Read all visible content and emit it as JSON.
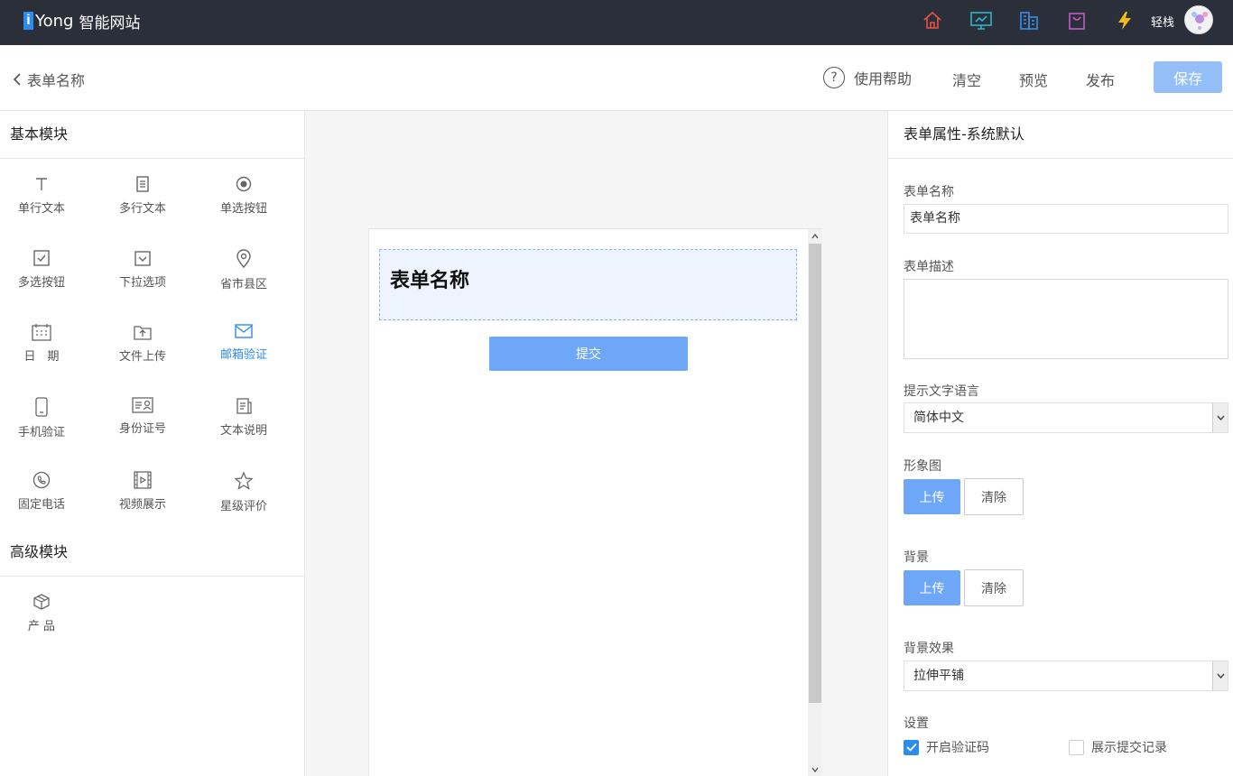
{
  "brand": {
    "mark": "i",
    "name": "Yong",
    "subtitle": "智能网站"
  },
  "topbar": {
    "icons": [
      "home-icon",
      "monitor-icon",
      "building-icon",
      "bag-icon",
      "lightning-icon"
    ],
    "user_name": "轻栈"
  },
  "subheader": {
    "back_label": "表单名称",
    "help_label": "使用帮助",
    "clear_label": "清空",
    "preview_label": "预览",
    "publish_label": "发布",
    "save_label": "保存"
  },
  "left": {
    "basic_title": "基本模块",
    "basic_modules": [
      {
        "label": "单行文本",
        "icon": "text-icon"
      },
      {
        "label": "多行文本",
        "icon": "textarea-icon"
      },
      {
        "label": "单选按钮",
        "icon": "radio-icon"
      },
      {
        "label": "多选按钮",
        "icon": "checkbox-icon"
      },
      {
        "label": "下拉选项",
        "icon": "dropdown-icon"
      },
      {
        "label": "省市县区",
        "icon": "location-icon"
      },
      {
        "label": "日　期",
        "icon": "calendar-icon"
      },
      {
        "label": "文件上传",
        "icon": "upload-icon"
      },
      {
        "label": "邮箱验证",
        "icon": "mail-icon"
      },
      {
        "label": "手机验证",
        "icon": "mobile-icon"
      },
      {
        "label": "身份证号",
        "icon": "idcard-icon"
      },
      {
        "label": "文本说明",
        "icon": "document-icon"
      },
      {
        "label": "固定电话",
        "icon": "phone-icon"
      },
      {
        "label": "视频展示",
        "icon": "video-icon"
      },
      {
        "label": "星级评价",
        "icon": "star-icon"
      }
    ],
    "advanced_title": "高级模块",
    "advanced_modules": [
      {
        "label": "产 品",
        "icon": "cube-icon"
      }
    ]
  },
  "preview": {
    "form_title": "表单名称",
    "submit_label": "提交"
  },
  "right": {
    "title": "表单属性-系统默认",
    "name_label": "表单名称",
    "name_value": "表单名称",
    "desc_label": "表单描述",
    "desc_value": "",
    "lang_label": "提示文字语言",
    "lang_value": "简体中文",
    "image_label": "形象图",
    "upload_label": "上传",
    "clear_label": "清除",
    "bg_label": "背景",
    "bg_effect_label": "背景效果",
    "bg_effect_value": "拉伸平铺",
    "settings_label": "设置",
    "captcha_label": "开启验证码",
    "captcha_checked": true,
    "records_label": "展示提交记录",
    "records_checked": false
  },
  "colors": {
    "topbar": "#2b2f3a",
    "accent": "#2d8cf0",
    "button": "#6ea6f8",
    "save_disabled": "#94bff8"
  }
}
